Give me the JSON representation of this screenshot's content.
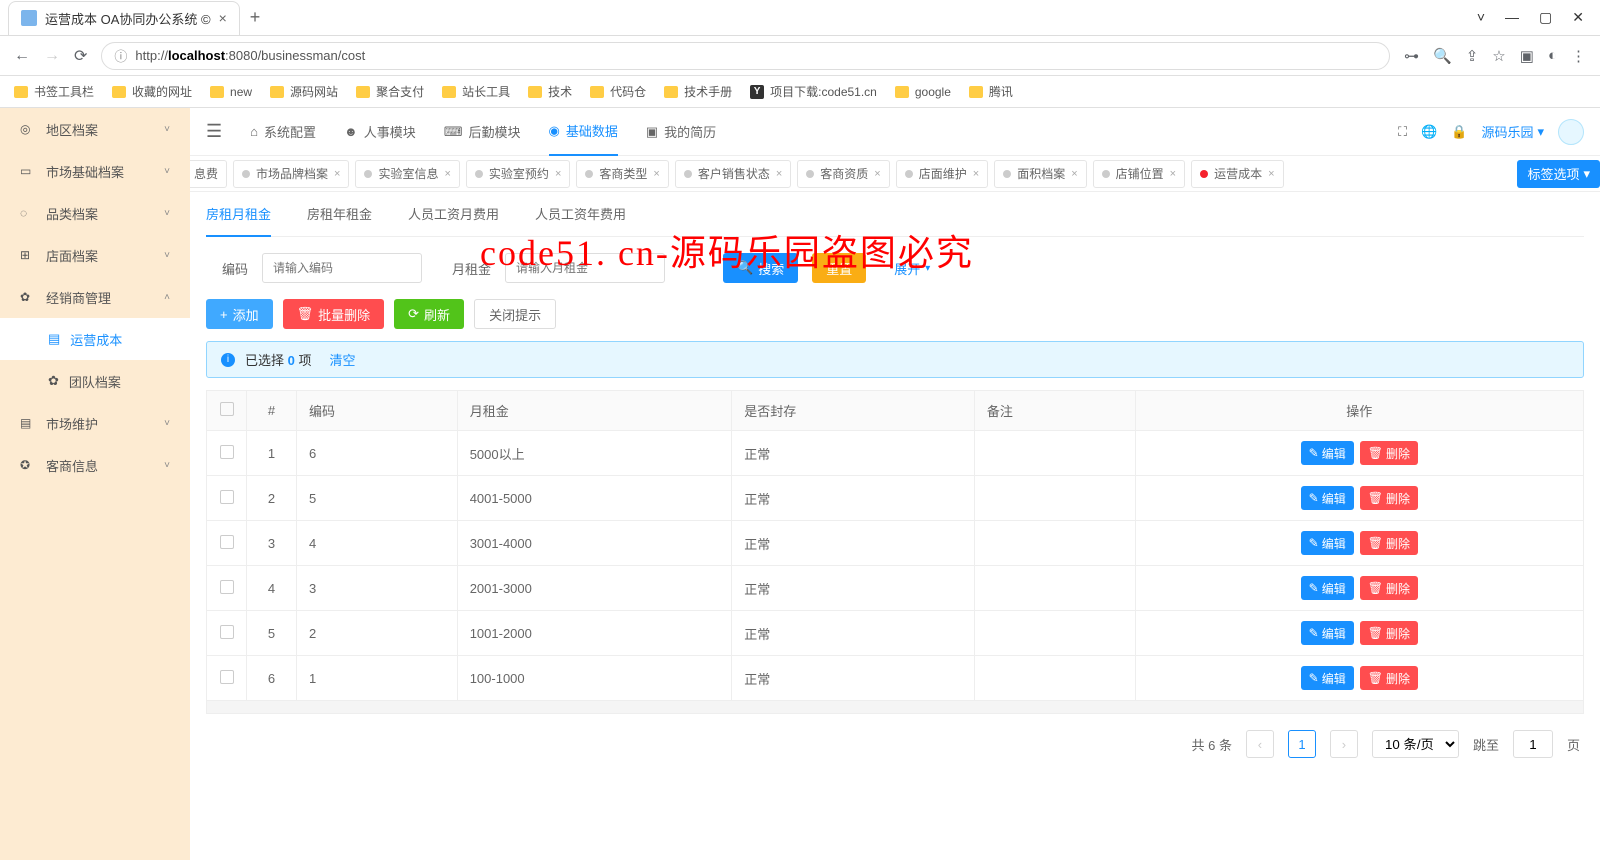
{
  "browser": {
    "tab_title": "运营成本 OA协同办公系统 ©",
    "url_prefix": "http://",
    "url_host": "localhost",
    "url_rest": ":8080/businessman/cost",
    "bookmarks": [
      {
        "label": "书签工具栏",
        "type": "folder"
      },
      {
        "label": "收藏的网址",
        "type": "folder"
      },
      {
        "label": "new",
        "type": "folder"
      },
      {
        "label": "源码网站",
        "type": "folder"
      },
      {
        "label": "聚合支付",
        "type": "folder"
      },
      {
        "label": "站长工具",
        "type": "folder"
      },
      {
        "label": "技术",
        "type": "folder"
      },
      {
        "label": "代码仓",
        "type": "folder"
      },
      {
        "label": "技术手册",
        "type": "folder"
      },
      {
        "label": "项目下载:code51.cn",
        "type": "icon"
      },
      {
        "label": "google",
        "type": "folder"
      },
      {
        "label": "腾讯",
        "type": "folder"
      }
    ]
  },
  "sidebar": {
    "items": [
      {
        "icon": "◎",
        "label": "地区档案",
        "exp": "˅"
      },
      {
        "icon": "▭",
        "label": "市场基础档案",
        "exp": "˅"
      },
      {
        "icon": "◌",
        "label": "品类档案",
        "exp": "˅"
      },
      {
        "icon": "⊞",
        "label": "店面档案",
        "exp": "˅"
      },
      {
        "icon": "✿",
        "label": "经销商管理",
        "exp": "˄",
        "open": true
      },
      {
        "icon": "▤",
        "label": "市场维护",
        "exp": "˅"
      },
      {
        "icon": "✪",
        "label": "客商信息",
        "exp": "˅"
      }
    ],
    "subs": [
      {
        "icon": "▤",
        "label": "运营成本",
        "active": true
      },
      {
        "icon": "✿",
        "label": "团队档案"
      }
    ]
  },
  "topmenu": {
    "items": [
      {
        "icon": "⌂",
        "label": "系统配置"
      },
      {
        "icon": "☻",
        "label": "人事模块"
      },
      {
        "icon": "⌨",
        "label": "后勤模块"
      },
      {
        "icon": "◉",
        "label": "基础数据",
        "active": true
      },
      {
        "icon": "▣",
        "label": "我的简历"
      }
    ],
    "user": "源码乐园"
  },
  "tabs": {
    "first_partial": "息费",
    "items": [
      {
        "label": "市场品牌档案"
      },
      {
        "label": "实验室信息"
      },
      {
        "label": "实验室预约"
      },
      {
        "label": "客商类型"
      },
      {
        "label": "客户销售状态"
      },
      {
        "label": "客商资质"
      },
      {
        "label": "店面维护"
      },
      {
        "label": "面积档案"
      },
      {
        "label": "店铺位置"
      },
      {
        "label": "运营成本",
        "active": true
      }
    ],
    "opts_label": "标签选项"
  },
  "subtabs": [
    "房租月租金",
    "房租年租金",
    "人员工资月费用",
    "人员工资年费用"
  ],
  "search": {
    "code_label": "编码",
    "code_ph": "请输入编码",
    "rent_label": "月租金",
    "rent_ph": "请输入月租金",
    "search_btn": "搜索",
    "reset_btn": "重置",
    "expand_btn": "展开"
  },
  "actions": {
    "add": "添加",
    "del": "批量删除",
    "refresh": "刷新",
    "close_tip": "关闭提示"
  },
  "alert": {
    "pre": "已选择",
    "count": "0",
    "suf": "项",
    "clear": "清空"
  },
  "table": {
    "cols": [
      "#",
      "编码",
      "月租金",
      "是否封存",
      "备注",
      "操作"
    ],
    "edit": "编辑",
    "del": "删除",
    "rows": [
      {
        "idx": "1",
        "code": "6",
        "rent": "5000以上",
        "sealed": "正常",
        "note": ""
      },
      {
        "idx": "2",
        "code": "5",
        "rent": "4001-5000",
        "sealed": "正常",
        "note": ""
      },
      {
        "idx": "3",
        "code": "4",
        "rent": "3001-4000",
        "sealed": "正常",
        "note": ""
      },
      {
        "idx": "4",
        "code": "3",
        "rent": "2001-3000",
        "sealed": "正常",
        "note": ""
      },
      {
        "idx": "5",
        "code": "2",
        "rent": "1001-2000",
        "sealed": "正常",
        "note": ""
      },
      {
        "idx": "6",
        "code": "1",
        "rent": "100-1000",
        "sealed": "正常",
        "note": ""
      }
    ]
  },
  "pager": {
    "total": "共 6 条",
    "page": "1",
    "size": "10 条/页",
    "jump": "跳至",
    "jump_val": "1",
    "page_unit": "页"
  },
  "watermark": "code51. cn-源码乐园盗图必究"
}
